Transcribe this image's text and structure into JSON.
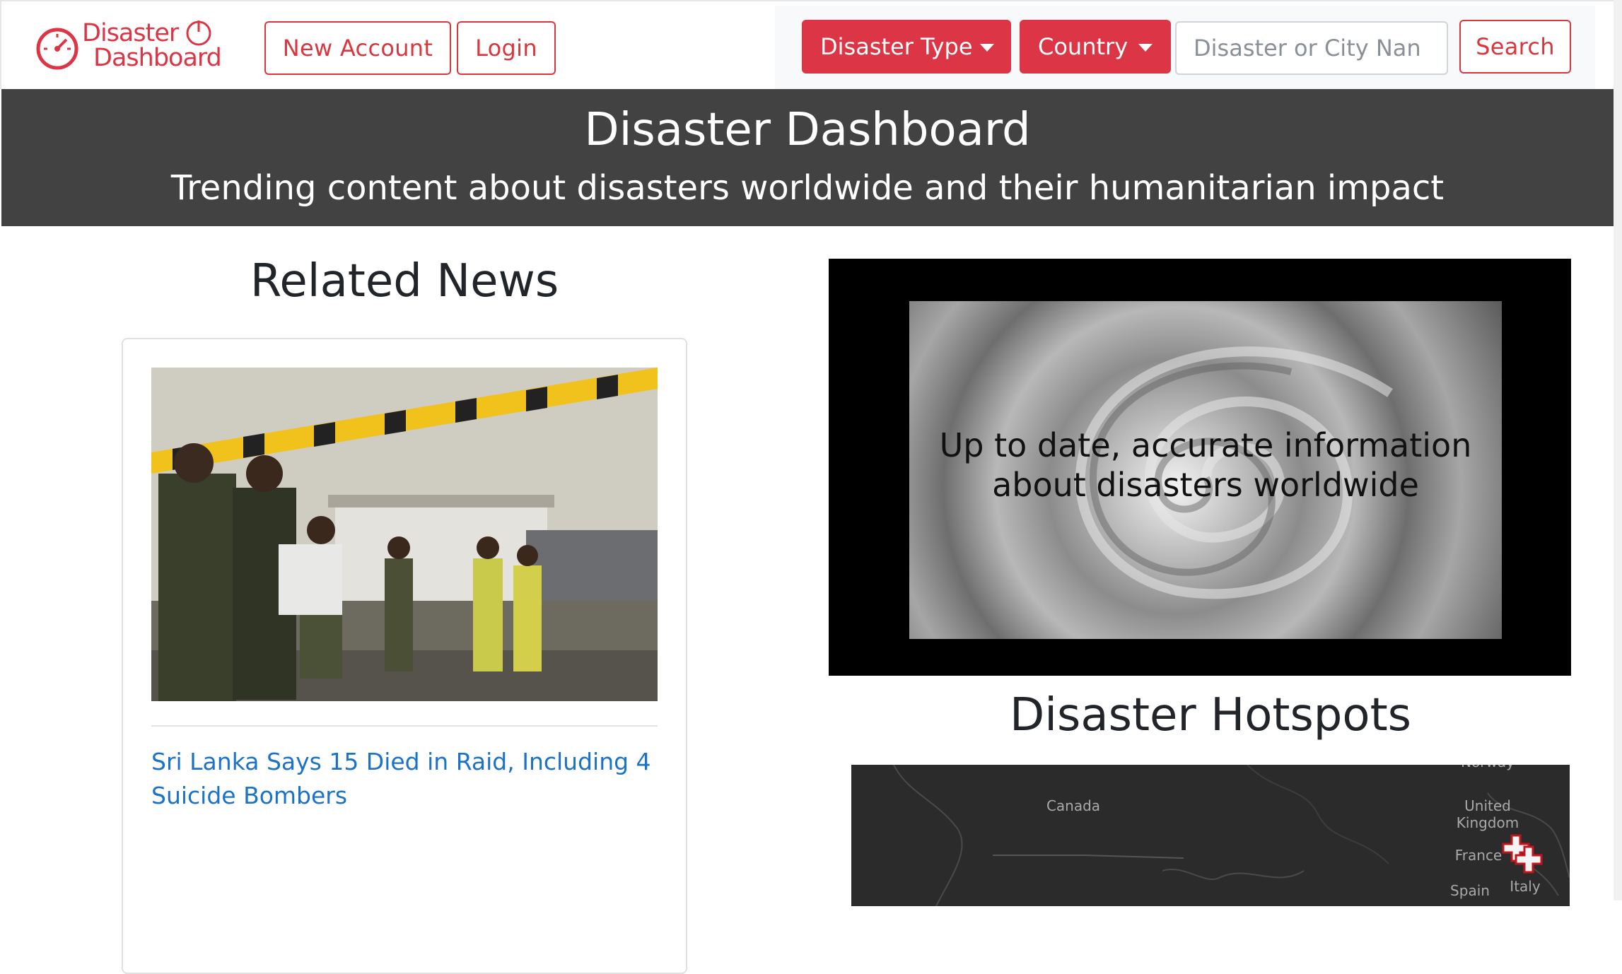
{
  "brand": {
    "line1": "Disaster",
    "line2": "Dashboard",
    "color": "#dc3545"
  },
  "nav": {
    "new_account": "New Account",
    "login": "Login"
  },
  "search": {
    "disaster_type": "Disaster Type",
    "country": "Country",
    "placeholder": "Disaster or City Nan",
    "button": "Search"
  },
  "banner": {
    "title": "Disaster Dashboard",
    "subtitle": "Trending content about disasters worldwide and their humanitarian impact"
  },
  "news": {
    "heading": "Related News",
    "article_title": "Sri Lanka Says 15 Died in Raid, Including 4 Suicide Bombers"
  },
  "video": {
    "caption": "Up to date, accurate information about disasters worldwide"
  },
  "hotspots": {
    "heading": "Disaster Hotspots",
    "labels": {
      "canada": "Canada",
      "uk": "United Kingdom",
      "france": "France",
      "spain": "Spain",
      "italy": "Italy",
      "norway": "Norway"
    }
  }
}
